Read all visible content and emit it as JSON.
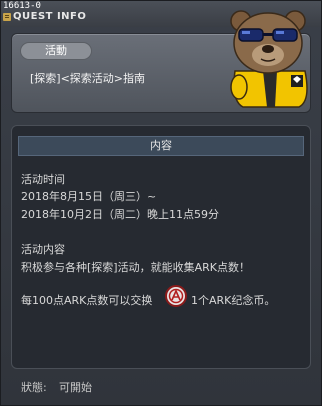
{
  "window": {
    "quest_id": "16613-0",
    "title": "QUEST INFO"
  },
  "quest": {
    "category": "活動",
    "name": "[探索]<探索活动>指南"
  },
  "content": {
    "header": "内容",
    "lines": {
      "time_label": "活动时间",
      "time_start": "2018年8月15日（周三）~",
      "time_end": "2018年10月2日（周二）晚上11点59分",
      "details_label": "活动内容",
      "details_text": "积极参与各种[探索]活动，就能收集ARK点数！",
      "exchange_before": "每100点ARK点数可以交换",
      "exchange_after": "1个ARK纪念币。"
    }
  },
  "status": {
    "label": "狀態:",
    "value": "可開始"
  },
  "colors": {
    "panel_bg": "#262a31",
    "header_bg": "#3c4a5a",
    "pill_bg": "#8c9097",
    "bear_body": "#8a6a4a",
    "jacket": "#f2c400"
  },
  "icons": {
    "title_icon": "quest-scroll-icon",
    "coin_icon": "ark-coin-icon",
    "character": "bear-mascot"
  }
}
